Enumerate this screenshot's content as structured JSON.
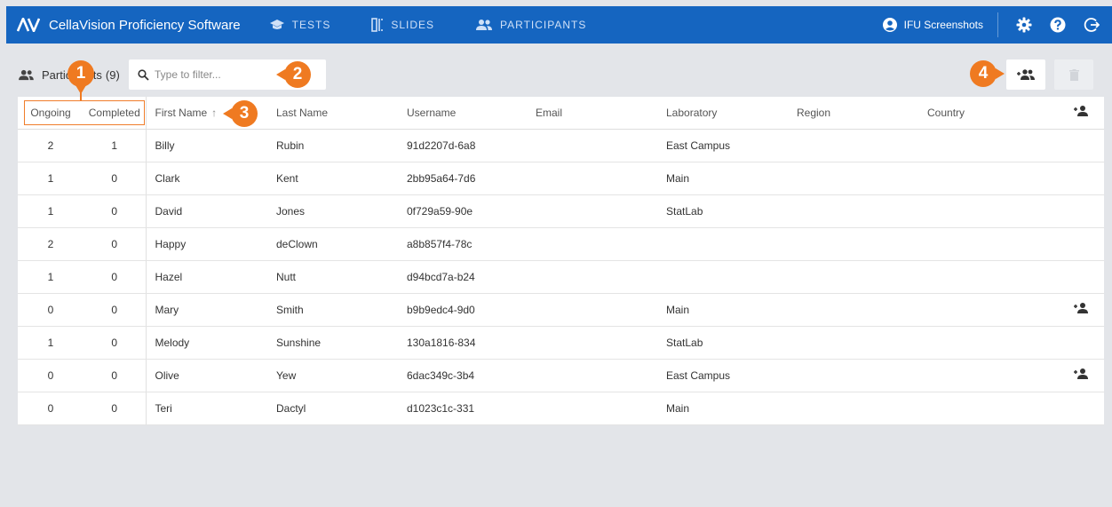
{
  "app": {
    "title": "CellaVision Proficiency Software",
    "logo_text": "AV"
  },
  "nav": {
    "items": [
      {
        "label": "TESTS",
        "icon": "mortarboard-icon"
      },
      {
        "label": "SLIDES",
        "icon": "slides-icon"
      },
      {
        "label": "PARTICIPANTS",
        "icon": "people-icon"
      }
    ]
  },
  "user": {
    "name": "IFU Screenshots"
  },
  "participants": {
    "title": "Participants",
    "count": "(9)"
  },
  "filter": {
    "placeholder": "Type to filter...",
    "value": ""
  },
  "table": {
    "headers": {
      "ongoing": "Ongoing",
      "completed": "Completed",
      "first_name": "First Name",
      "last_name": "Last Name",
      "username": "Username",
      "email": "Email",
      "laboratory": "Laboratory",
      "region": "Region",
      "country": "Country"
    },
    "rows": [
      {
        "ongoing": "2",
        "completed": "1",
        "first_name": "Billy",
        "last_name": "Rubin",
        "username": "91d2207d-6a8",
        "email": "",
        "laboratory": "East Campus",
        "region": "",
        "country": "",
        "admin": false
      },
      {
        "ongoing": "1",
        "completed": "0",
        "first_name": "Clark",
        "last_name": "Kent",
        "username": "2bb95a64-7d6",
        "email": "",
        "laboratory": "Main",
        "region": "",
        "country": "",
        "admin": false
      },
      {
        "ongoing": "1",
        "completed": "0",
        "first_name": "David",
        "last_name": "Jones",
        "username": "0f729a59-90e",
        "email": "",
        "laboratory": "StatLab",
        "region": "",
        "country": "",
        "admin": false
      },
      {
        "ongoing": "2",
        "completed": "0",
        "first_name": "Happy",
        "last_name": "deClown",
        "username": "a8b857f4-78c",
        "email": "",
        "laboratory": "",
        "region": "",
        "country": "",
        "admin": false
      },
      {
        "ongoing": "1",
        "completed": "0",
        "first_name": "Hazel",
        "last_name": "Nutt",
        "username": "d94bcd7a-b24",
        "email": "",
        "laboratory": "",
        "region": "",
        "country": "",
        "admin": false
      },
      {
        "ongoing": "0",
        "completed": "0",
        "first_name": "Mary",
        "last_name": "Smith",
        "username": "b9b9edc4-9d0",
        "email": "",
        "laboratory": "Main",
        "region": "",
        "country": "",
        "admin": true
      },
      {
        "ongoing": "1",
        "completed": "0",
        "first_name": "Melody",
        "last_name": "Sunshine",
        "username": "130a1816-834",
        "email": "",
        "laboratory": "StatLab",
        "region": "",
        "country": "",
        "admin": false
      },
      {
        "ongoing": "0",
        "completed": "0",
        "first_name": "Olive",
        "last_name": "Yew",
        "username": "6dac349c-3b4",
        "email": "",
        "laboratory": "East Campus",
        "region": "",
        "country": "",
        "admin": true
      },
      {
        "ongoing": "0",
        "completed": "0",
        "first_name": "Teri",
        "last_name": "Dactyl",
        "username": "d1023c1c-331",
        "email": "",
        "laboratory": "Main",
        "region": "",
        "country": "",
        "admin": false
      }
    ]
  },
  "callouts": [
    "1",
    "2",
    "3",
    "4"
  ],
  "colors": {
    "topbar": "#1565c0",
    "accent": "#ef7a21",
    "background": "#e3e5e9"
  }
}
